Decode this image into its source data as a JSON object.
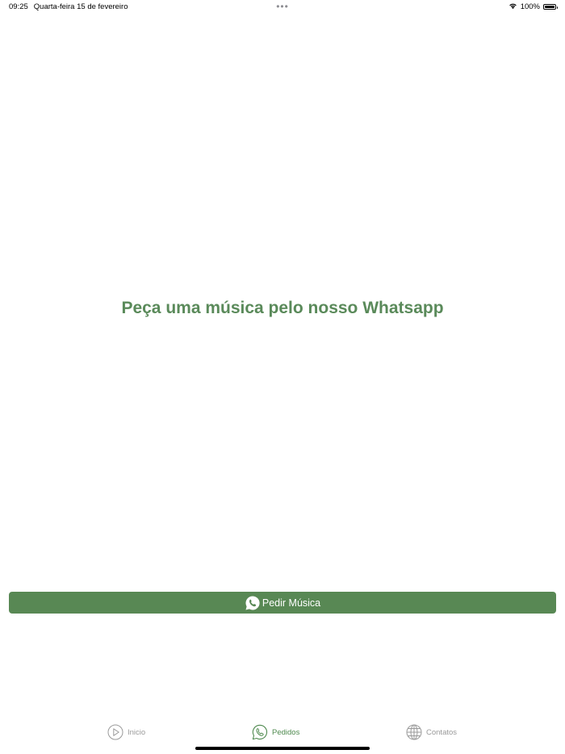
{
  "status_bar": {
    "time": "09:25",
    "date": "Quarta-feira 15 de fevereiro",
    "battery": "100%",
    "battery_level": 1.0
  },
  "main": {
    "headline": "Peça uma música pelo nosso Whatsapp",
    "order_button_label": "Pedir Música",
    "order_button_icon": "whatsapp-icon"
  },
  "tab_bar": {
    "tabs": [
      {
        "label": "Inicio",
        "icon": "play-icon",
        "active": false
      },
      {
        "label": "Pedidos",
        "icon": "whatsapp-icon",
        "active": true
      },
      {
        "label": "Contatos",
        "icon": "globe-icon",
        "active": false
      }
    ]
  },
  "colors": {
    "accent": "#588854",
    "headline": "#5a8a5a",
    "tab_inactive": "#9a9a9a",
    "tab_active": "#4f8a4f"
  }
}
